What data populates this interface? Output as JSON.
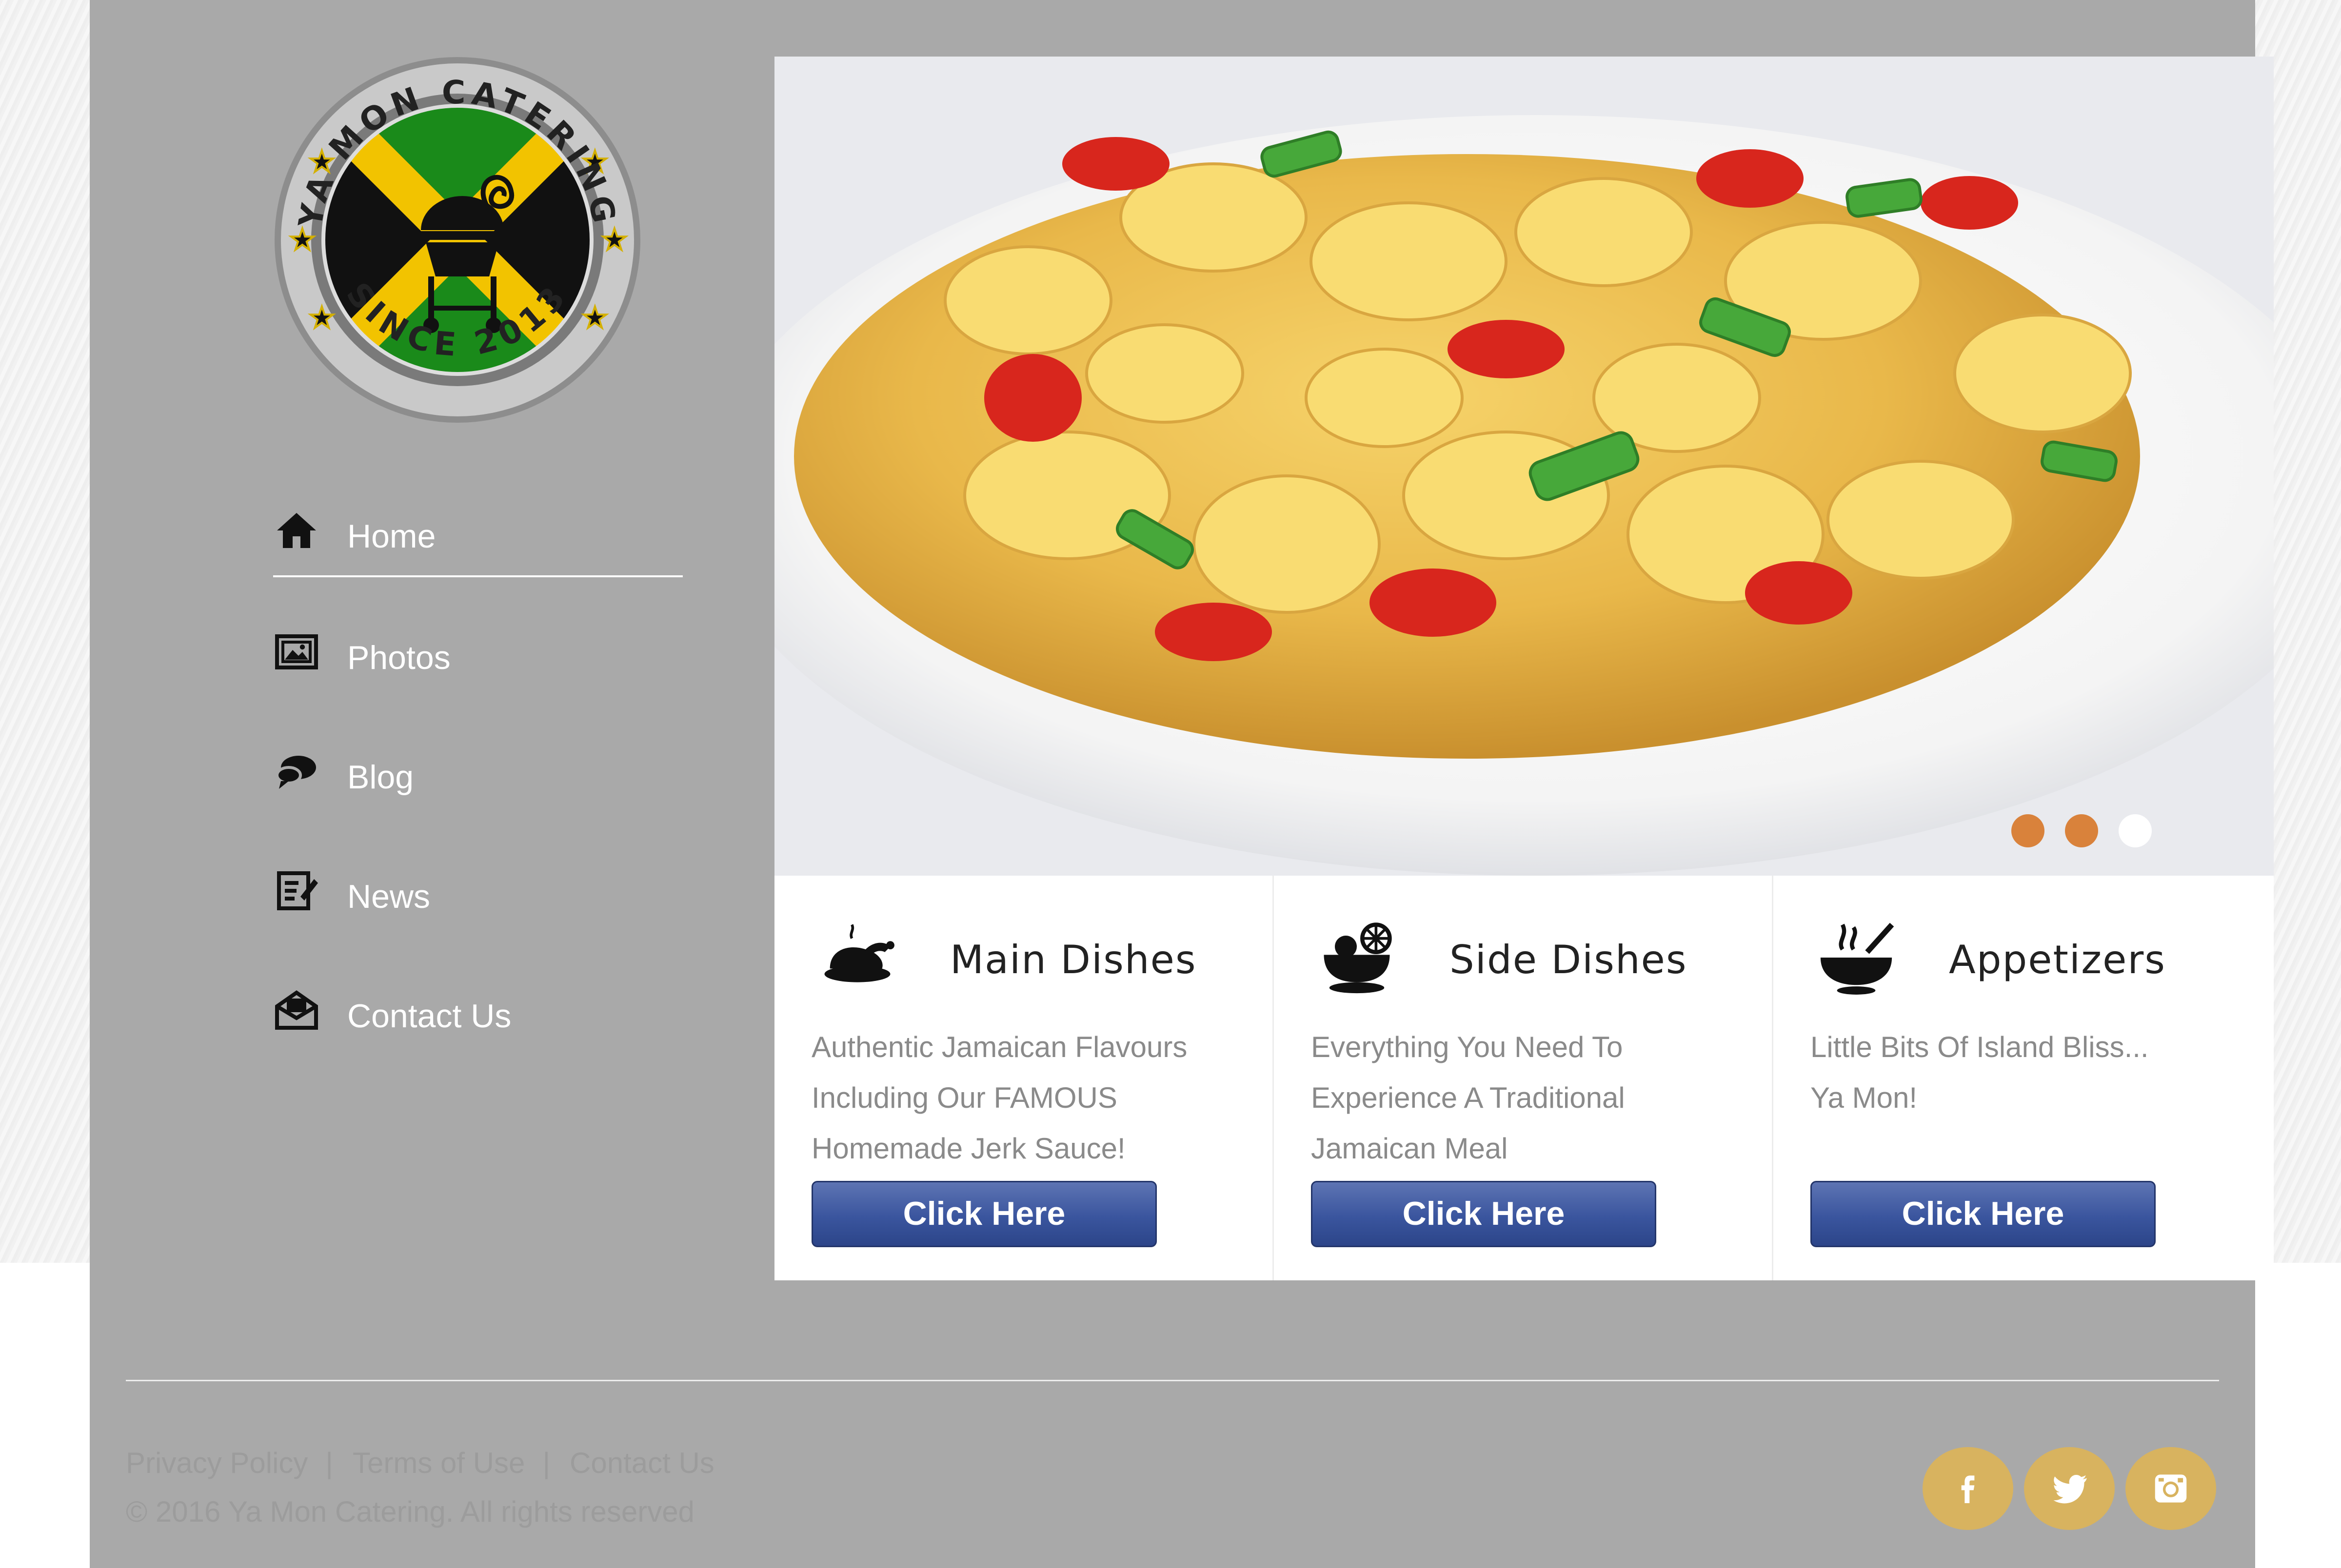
{
  "brand": {
    "logo_top_text": "YA MON CATERING",
    "logo_bottom_text": "SINCE 2013"
  },
  "nav": {
    "items": [
      {
        "label": "Home",
        "icon": "home-icon",
        "active": true
      },
      {
        "label": "Photos",
        "icon": "photo-icon",
        "active": false
      },
      {
        "label": "Blog",
        "icon": "chat-icon",
        "active": false
      },
      {
        "label": "News",
        "icon": "news-icon",
        "active": false
      },
      {
        "label": "Contact Us",
        "icon": "envelope-icon",
        "active": false
      }
    ]
  },
  "slider": {
    "image_alt": "ackee and saltfish dish",
    "dots": [
      {
        "state": "inactive",
        "color": "#d9823b"
      },
      {
        "state": "inactive",
        "color": "#d9823b"
      },
      {
        "state": "active",
        "color": "#ffffff"
      }
    ]
  },
  "features": [
    {
      "title": "Main Dishes",
      "icon": "roast-chicken-icon",
      "lines": [
        "Authentic Jamaican Flavours",
        "Including Our FAMOUS",
        "Homemade Jerk Sauce!"
      ],
      "button": "Click Here"
    },
    {
      "title": "Side Dishes",
      "icon": "salad-bowl-icon",
      "lines": [
        "Everything You Need To",
        "Experience A Traditional",
        "Jamaican Meal"
      ],
      "button": "Click Here"
    },
    {
      "title": "Appetizers",
      "icon": "steaming-bowl-icon",
      "lines": [
        "Little Bits Of Island Bliss...",
        "Ya Mon!"
      ],
      "button": "Click Here"
    }
  ],
  "footer": {
    "links": [
      "Privacy Policy",
      "Terms of Use",
      "Contact Us"
    ],
    "separator": "|",
    "copyright": "© 2016 Ya Mon Catering. All rights reserved",
    "social": [
      "facebook-icon",
      "twitter-icon",
      "instagram-icon"
    ]
  },
  "colors": {
    "panel": "#a9a9a9",
    "accent_dot": "#d9823b",
    "button": "#3a559e",
    "social_bg": "#d8b35f"
  }
}
